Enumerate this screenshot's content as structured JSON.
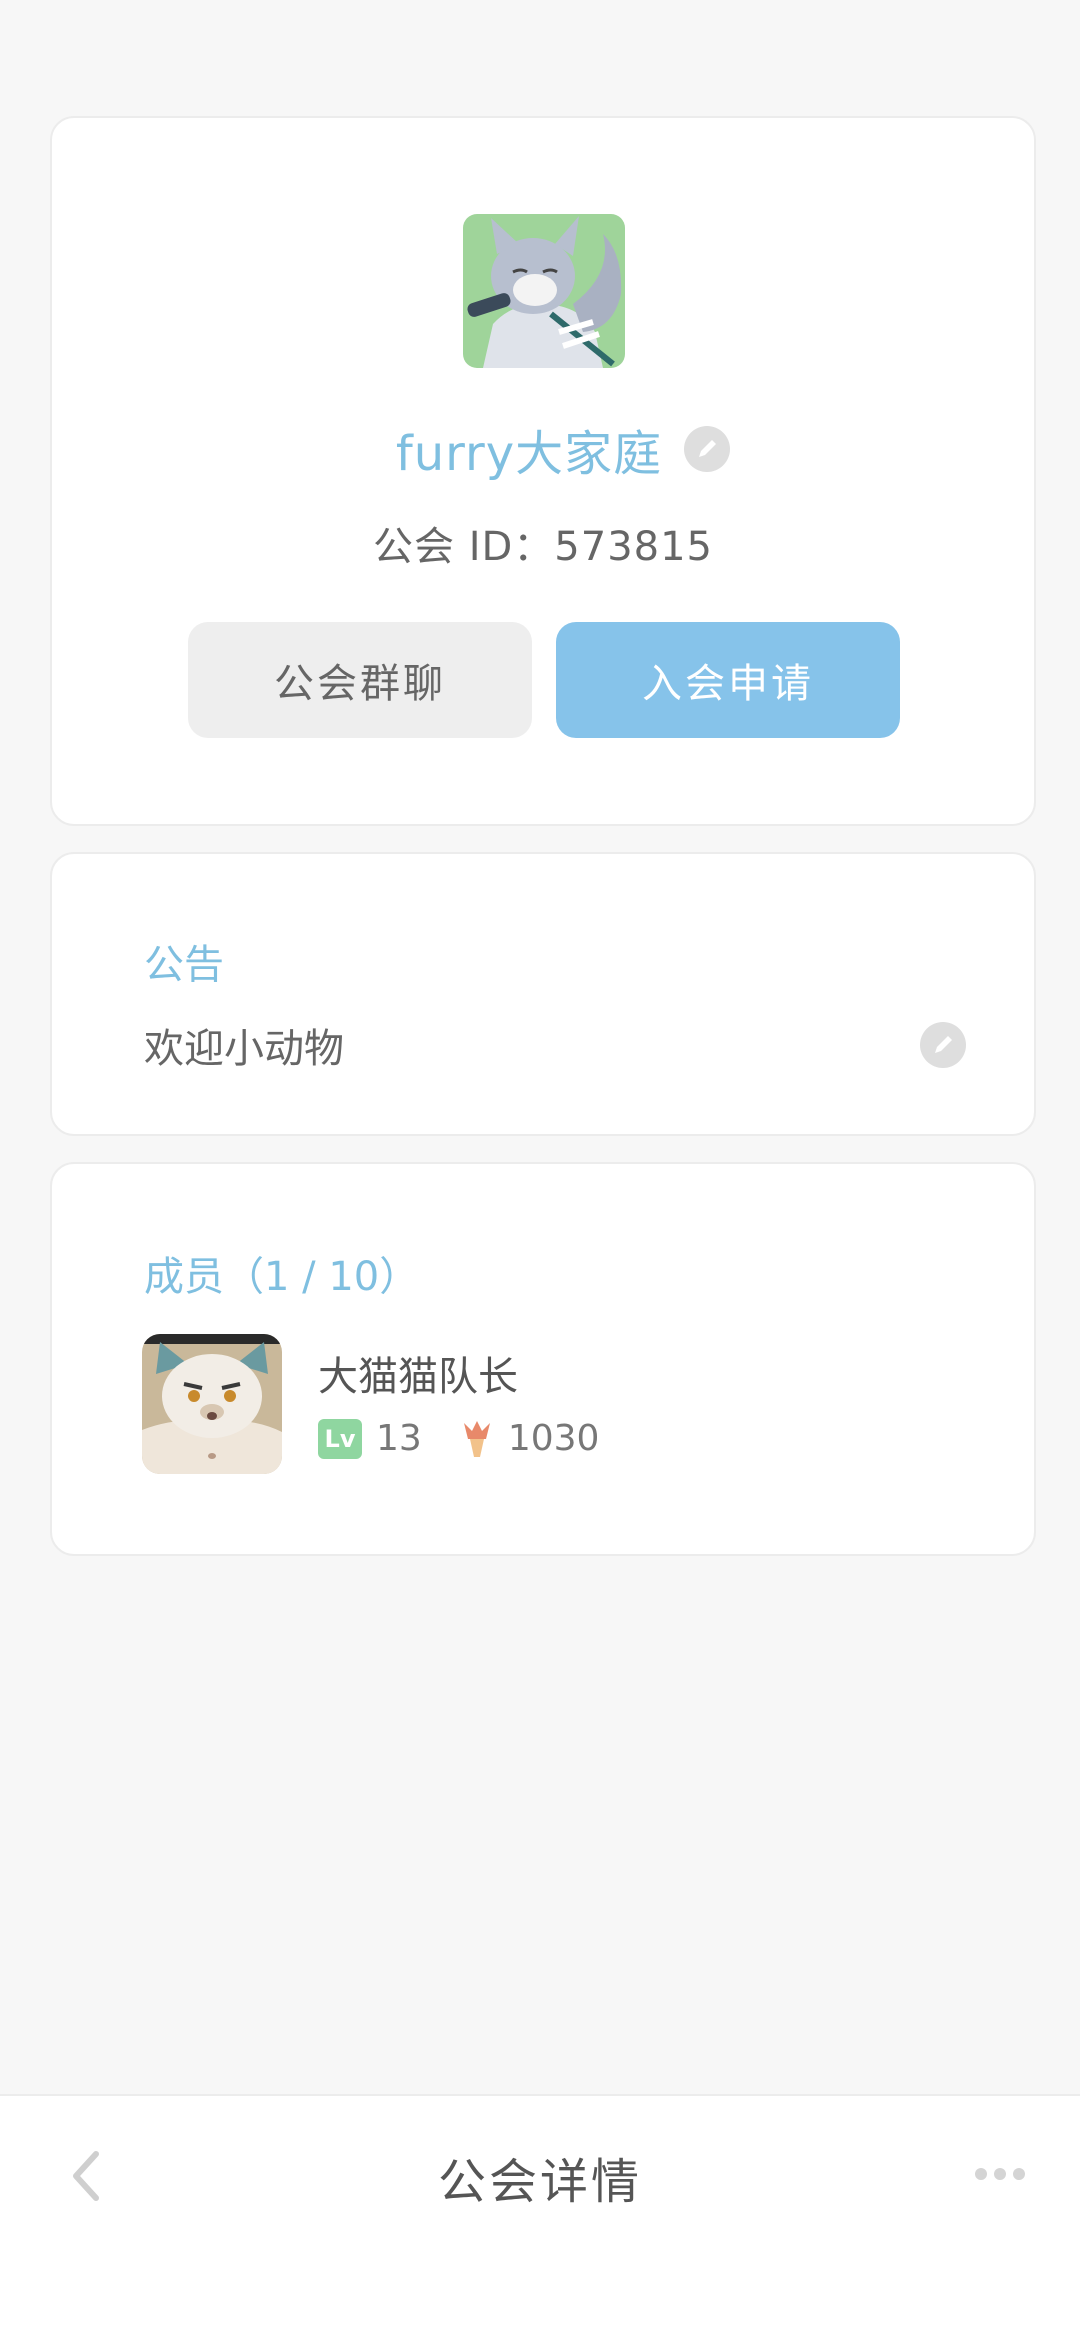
{
  "guild": {
    "name": "furry大家庭",
    "id_text": "公会 ID：573815",
    "chat_button": "公会群聊",
    "join_button": "入会申请",
    "avatar_icon": "wolf-avatar-icon"
  },
  "notice": {
    "title": "公告",
    "text": "欢迎小动物"
  },
  "members": {
    "title": "成员（1 / 10）",
    "list": [
      {
        "name": "大猫猫队长",
        "level_badge": "Lv",
        "level": "13",
        "score": "1030",
        "avatar_icon": "cat-avatar-icon",
        "score_icon": "torch-icon"
      }
    ]
  },
  "bottom_bar": {
    "title": "公会详情",
    "back_icon": "chevron-left-icon",
    "more_icon": "more-dots-icon"
  },
  "colors": {
    "accent": "#7fbfe0",
    "join_button": "#86c3ea",
    "level_badge": "#8fd6a0",
    "page_background": "#f7f7f7"
  }
}
